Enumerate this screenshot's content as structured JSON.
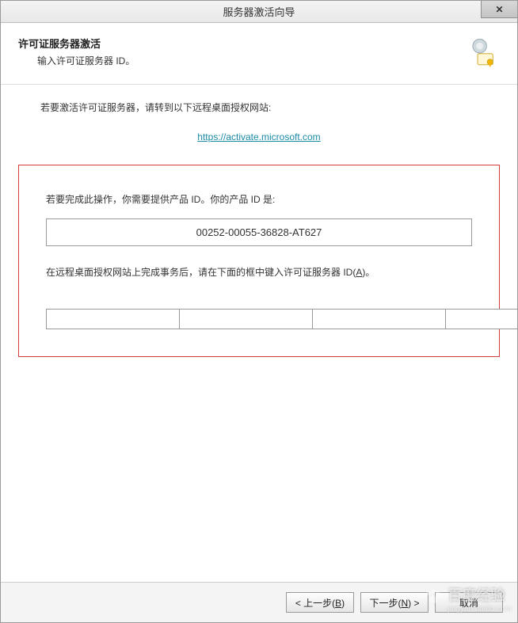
{
  "title": "服务器激活向导",
  "close_label": "✕",
  "header": {
    "heading": "许可证服务器激活",
    "subheading": "输入许可证服务器 ID。"
  },
  "content": {
    "intro": "若要激活许可证服务器，请转到以下远程桌面授权网站:",
    "link_text": "https://activate.microsoft.com",
    "product_id_intro": "若要完成此操作，你需要提供产品 ID。你的产品 ID 是:",
    "product_id": "00252-00055-36828-AT627",
    "instruction_prefix": "在远程桌面授权网站上完成事务后，请在下面的框中键入许可证服务器 ID(",
    "instruction_accel": "A",
    "instruction_suffix": ")。",
    "id_fields": [
      "",
      "",
      "",
      "",
      "",
      "",
      ""
    ]
  },
  "footer": {
    "back_prefix": "< 上一步(",
    "back_accel": "B",
    "back_suffix": ")",
    "next_prefix": "下一步(",
    "next_accel": "N",
    "next_suffix": ") >",
    "cancel": "取消"
  },
  "watermark": {
    "brand": "百度经验",
    "url": "jingyan.baidu.com"
  }
}
